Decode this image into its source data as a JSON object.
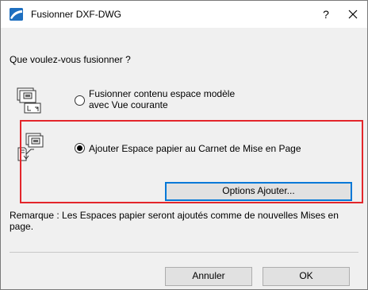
{
  "window": {
    "title": "Fusionner DXF-DWG",
    "help_label": "?",
    "close_icon": "close-icon",
    "app_icon": "archicad-icon"
  },
  "dialog": {
    "question": "Que voulez-vous fusionner ?",
    "options": [
      {
        "label": "Fusionner contenu espace modèle avec Vue courante",
        "selected": false,
        "icon": "model-space-merge-icon"
      },
      {
        "label": "Ajouter Espace papier au Carnet de Mise en Page",
        "selected": true,
        "icon": "paper-space-add-icon"
      }
    ],
    "options_button": "Options Ajouter...",
    "note": "Remarque : Les Espaces papier seront ajoutés comme de nouvelles Mises en page.",
    "highlight_color": "#e3262b"
  },
  "footer": {
    "cancel_label": "Annuler",
    "ok_label": "OK"
  }
}
